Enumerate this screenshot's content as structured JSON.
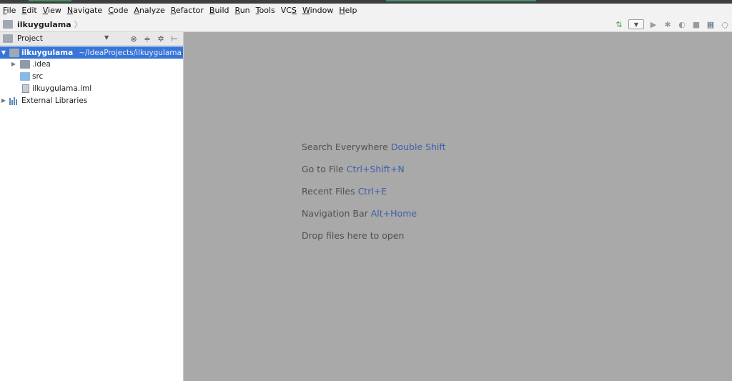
{
  "menu": [
    "File",
    "Edit",
    "View",
    "Navigate",
    "Code",
    "Analyze",
    "Refactor",
    "Build",
    "Run",
    "Tools",
    "VCS",
    "Window",
    "Help"
  ],
  "menu_mnemonic_index": [
    0,
    0,
    0,
    0,
    0,
    0,
    0,
    0,
    0,
    0,
    2,
    0,
    0
  ],
  "breadcrumb": {
    "project": "ilkuygulama"
  },
  "project_panel": {
    "title": "Project"
  },
  "tree": {
    "root": {
      "name": "ilkuygulama",
      "path": "~/IdeaProjects/ilkuygulama"
    },
    "items": [
      {
        "name": ".idea",
        "type": "folder"
      },
      {
        "name": "src",
        "type": "source-folder"
      },
      {
        "name": "ilkuygulama.iml",
        "type": "module-file"
      }
    ],
    "external": "External Libraries"
  },
  "editor_hints": [
    {
      "text": "Search Everywhere ",
      "key": "Double Shift"
    },
    {
      "text": "Go to File ",
      "key": "Ctrl+Shift+N"
    },
    {
      "text": "Recent Files ",
      "key": "Ctrl+E"
    },
    {
      "text": "Navigation Bar ",
      "key": "Alt+Home"
    },
    {
      "text": "Drop files here to open",
      "key": ""
    }
  ],
  "colors": {
    "selection": "#3875d7",
    "editor_bg": "#a9a9a9",
    "hint_key": "#3e5fa8"
  }
}
